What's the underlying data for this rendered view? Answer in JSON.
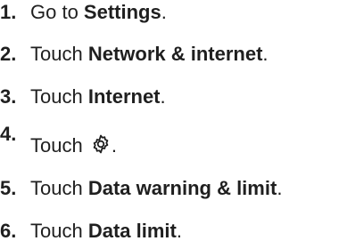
{
  "steps": [
    {
      "number": "1.",
      "text": "Go to ",
      "bold": "Settings",
      "suffix": "."
    },
    {
      "number": "2.",
      "text": "Touch ",
      "bold": "Network & internet",
      "suffix": "."
    },
    {
      "number": "3.",
      "text": "Touch ",
      "bold": "Internet",
      "suffix": "."
    },
    {
      "number": "4.",
      "text": "Touch ",
      "icon": "gear-icon",
      "suffix": "."
    },
    {
      "number": "5.",
      "text": "Touch ",
      "bold": "Data warning & limit",
      "suffix": "."
    },
    {
      "number": "6.",
      "text": "Touch ",
      "bold": "Data limit",
      "suffix": "."
    }
  ]
}
